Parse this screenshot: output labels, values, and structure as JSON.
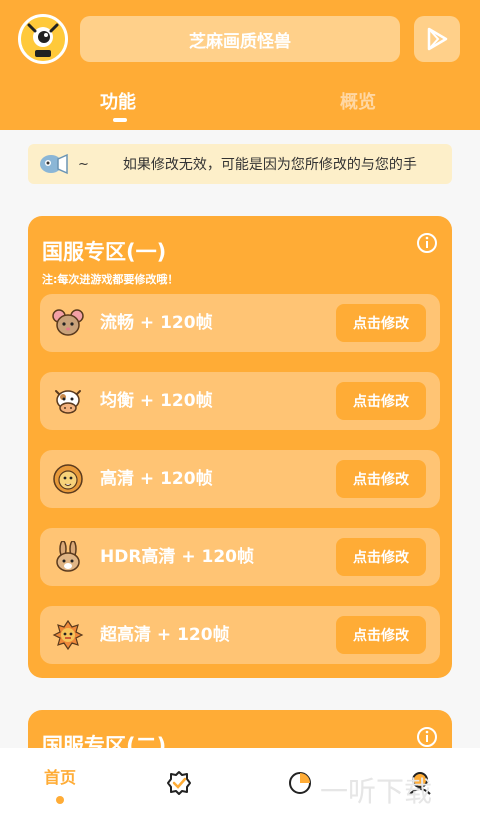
{
  "header": {
    "title": "芝麻画质怪兽",
    "tabs": [
      {
        "label": "功能",
        "active": true
      },
      {
        "label": "概览",
        "active": false
      }
    ]
  },
  "notice": {
    "tilde": "~",
    "text": "如果修改无效，可能是因为您所修改的与您的手"
  },
  "section1": {
    "title": "国服专区(一)",
    "note": "注:每次进游戏都要修改哦！",
    "rows": [
      {
        "label": "流畅 + 120帧",
        "icon": "mouse-icon",
        "button": "点击修改"
      },
      {
        "label": "均衡 + 120帧",
        "icon": "cow-icon",
        "button": "点击修改"
      },
      {
        "label": "高清 + 120帧",
        "icon": "lion-icon",
        "button": "点击修改"
      },
      {
        "label": "HDR高清 + 120帧",
        "icon": "rabbit-icon",
        "button": "点击修改"
      },
      {
        "label": "超高清 + 120帧",
        "icon": "dragon-icon",
        "button": "点击修改"
      }
    ]
  },
  "section2": {
    "title": "国服专区(二)"
  },
  "bottom_nav": {
    "home_label": "首页"
  },
  "watermark": "一听下载",
  "colors": {
    "accent": "#ffac36",
    "row_bg": "#ffc474",
    "notice_bg": "#fdefc9"
  }
}
